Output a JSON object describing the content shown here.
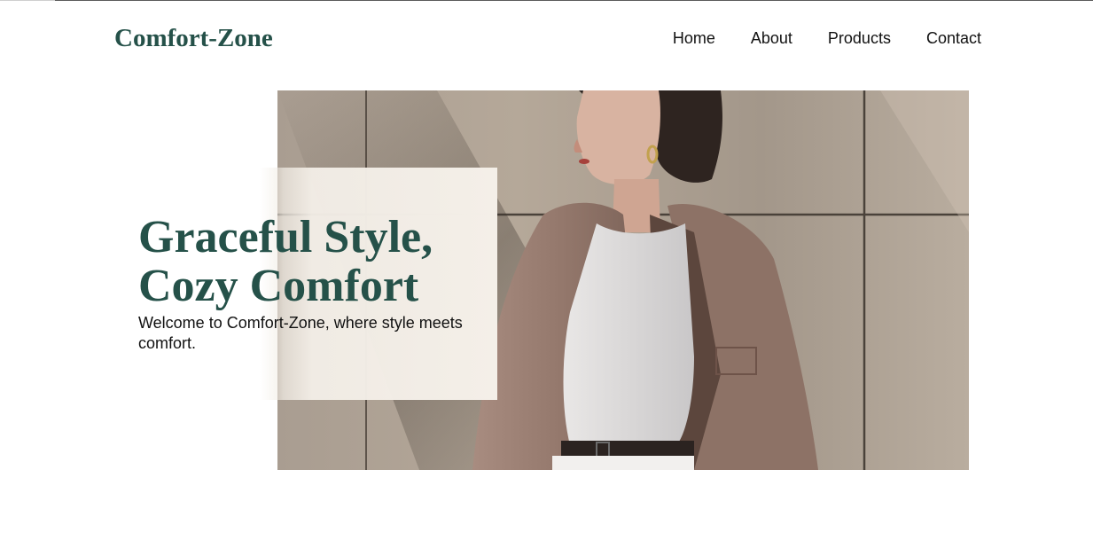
{
  "brand": {
    "logo_text": "Comfort-Zone",
    "color": "#255149"
  },
  "nav": {
    "items": [
      {
        "label": "Home"
      },
      {
        "label": "About"
      },
      {
        "label": "Products"
      },
      {
        "label": "Contact"
      }
    ]
  },
  "hero": {
    "title_line1": "Graceful Style,",
    "title_line2": "Cozy Comfort",
    "subtitle": "Welcome to Comfort-Zone, where style meets comfort.",
    "image_subject": "woman-in-beige-blazer-photo"
  }
}
